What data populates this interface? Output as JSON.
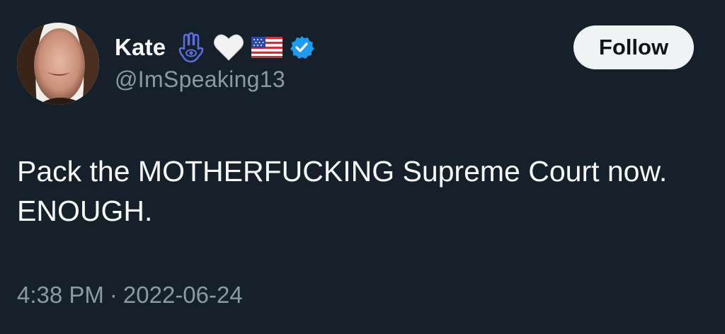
{
  "user": {
    "display_name": "Kate",
    "handle": "@ImSpeaking13",
    "verified": true,
    "name_emojis": [
      "hamsa-icon",
      "white-heart-icon",
      "us-flag-icon"
    ]
  },
  "follow_button": {
    "label": "Follow"
  },
  "tweet": {
    "text": "Pack the MOTHERFUCKING Supreme Court now.\nENOUGH."
  },
  "meta": {
    "time": "4:38 PM",
    "separator": "·",
    "date": "2022-06-24"
  },
  "colors": {
    "background": "#15202b",
    "text": "#f7f9f9",
    "secondary": "#8b98a5",
    "verified": "#1d9bf0",
    "button_bg": "#eff3f4"
  }
}
